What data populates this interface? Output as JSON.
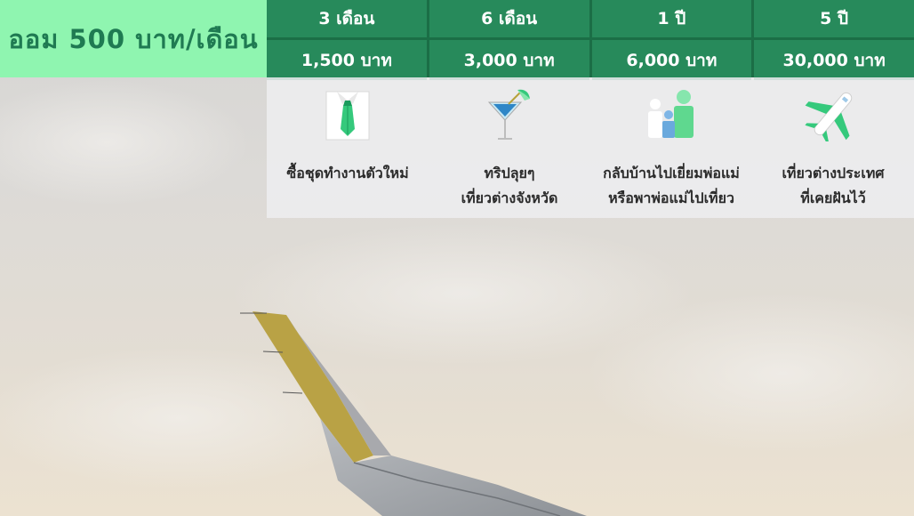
{
  "header": {
    "save_label": "ออม  500 บาท/เดือน"
  },
  "periods": [
    {
      "duration": "3 เดือน",
      "amount": "1,500 บาท",
      "desc_lines": [
        "ซื้อชุดทำงานตัวใหม่"
      ],
      "icon": "shirt-tie-icon"
    },
    {
      "duration": "6 เดือน",
      "amount": "3,000 บาท",
      "desc_lines": [
        "ทริปลุยๆ",
        "เที่ยวต่างจังหวัด"
      ],
      "icon": "cocktail-icon"
    },
    {
      "duration": "1 ปี",
      "amount": "6,000 บาท",
      "desc_lines": [
        "กลับบ้านไปเยี่ยมพ่อแม่",
        "หรือพาพ่อแม่ไปเที่ยว"
      ],
      "icon": "family-icon"
    },
    {
      "duration": "5 ปี",
      "amount": "30,000 บาท",
      "desc_lines": [
        "เที่ยวต่างประเทศ",
        "ที่เคยฝันไว้"
      ],
      "icon": "airplane-icon"
    }
  ],
  "colors": {
    "label_bg": "#8ff5b0",
    "label_text": "#1f7a52",
    "cell_bg": "#278a5b",
    "panel_bg": "#eeeef0"
  }
}
